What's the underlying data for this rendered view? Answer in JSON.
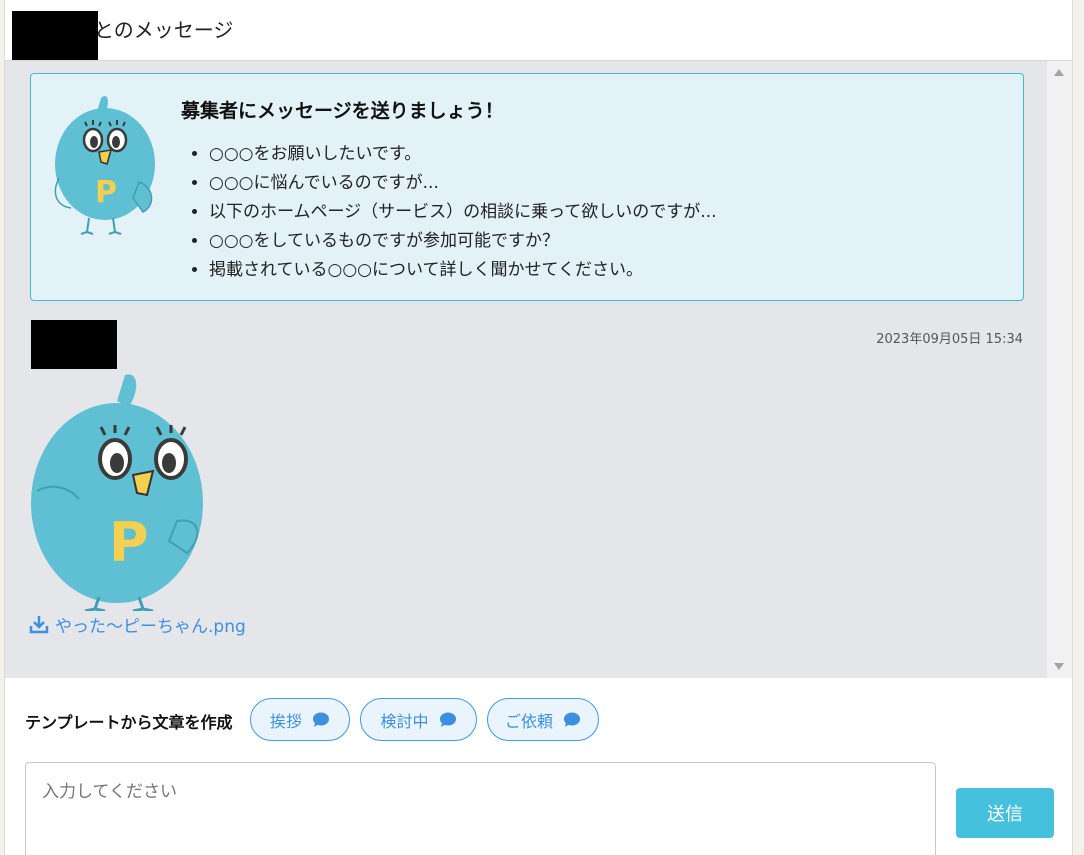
{
  "header": {
    "title": "とのメッセージ"
  },
  "tip": {
    "title": "募集者にメッセージを送りましょう！",
    "items": [
      "○○○をお願いしたいです。",
      "○○○に悩んでいるのですが...",
      "以下のホームページ（サービス）の相談に乗って欲しいのですが...",
      "○○○をしているものですが参加可能ですか？",
      "掲載されている○○○について詳しく聞かせてください。"
    ]
  },
  "message": {
    "timestamp": "2023年09月05日 15:34",
    "attachment_name": "やった～ピーちゃん.png"
  },
  "composer": {
    "template_label": "テンプレートから文章を作成",
    "templates": [
      "挨拶",
      "検討中",
      "ご依頼"
    ],
    "placeholder": "入力してください",
    "send_label": "送信"
  },
  "colors": {
    "accent": "#45c1de",
    "link": "#3d8fe0",
    "tip_background": "#e3f2f7",
    "messages_background": "#e5e6ea",
    "mascot_body": "#5fbfd3",
    "mascot_letter": "#f3d04f"
  },
  "icons": {
    "template_button": "speech-bubble-icon",
    "attachment": "download-icon"
  }
}
